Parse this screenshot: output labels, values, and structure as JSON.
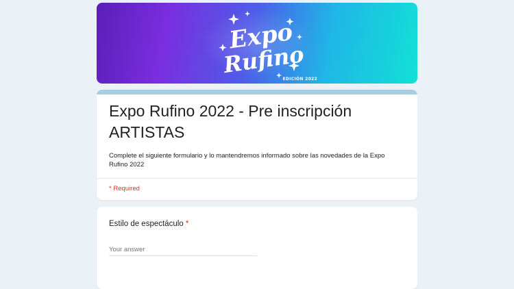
{
  "banner": {
    "logo_line1": "Expo",
    "logo_line2": "Rufino",
    "edition": "EDICIÓN 2022"
  },
  "form": {
    "title": "Expo Rufino 2022 - Pre inscripción ARTISTAS",
    "description": "Complete el siguiente formulario y lo mantendremos informado sobre las novedades de la Expo Rufino 2022",
    "required_note": "* Required"
  },
  "question": {
    "label": "Estilo de espectáculo",
    "required_mark": "*",
    "placeholder": "Your answer",
    "value": ""
  },
  "colors": {
    "page_background": "#eaf1f7",
    "card_accent": "#a8cde3",
    "required_red": "#d93025",
    "banner_gradient_start": "#5a1fb8",
    "banner_gradient_end": "#12e0d6"
  }
}
